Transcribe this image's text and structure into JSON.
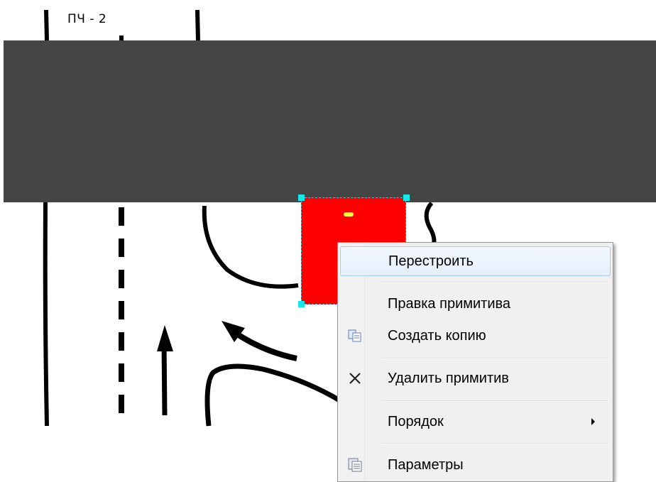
{
  "canvas": {
    "label": "ПЧ - 2",
    "band_color": "#454545",
    "primitive_color": "#ff0000",
    "selection_color": "#19e6e6"
  },
  "context_menu": {
    "items": [
      {
        "label": "Перестроить",
        "icon": "",
        "highlighted": true
      },
      {
        "label": "Правка примитива",
        "icon": ""
      },
      {
        "label": "Создать копию",
        "icon": "copy-icon"
      },
      {
        "label": "Удалить примитив",
        "icon": "delete-x-icon"
      },
      {
        "label": "Порядок",
        "icon": "",
        "submenu": true
      },
      {
        "label": "Параметры",
        "icon": "properties-icon"
      }
    ]
  }
}
